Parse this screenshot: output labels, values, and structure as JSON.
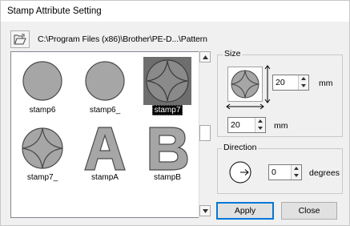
{
  "window": {
    "title": "Stamp Attribute Setting"
  },
  "toolbar": {
    "folder_icon": "open-folder-icon",
    "path": "C:\\Program Files (x86)\\Brother\\PE-D...\\Pattern"
  },
  "stamps": [
    {
      "label": "stamp6",
      "shape": "circle",
      "selected": false
    },
    {
      "label": "stamp6_",
      "shape": "circle",
      "selected": false
    },
    {
      "label": "stamp7",
      "shape": "circle-star",
      "selected": true
    },
    {
      "label": "stamp7_",
      "shape": "circle-star",
      "selected": false
    },
    {
      "label": "stampA",
      "shape": "letter-A",
      "selected": false
    },
    {
      "label": "stampB",
      "shape": "letter-B",
      "selected": false
    }
  ],
  "size": {
    "group_label": "Size",
    "height_value": "20",
    "height_unit": "mm",
    "width_value": "20",
    "width_unit": "mm"
  },
  "direction": {
    "group_label": "Direction",
    "value": "0",
    "unit": "degrees"
  },
  "buttons": {
    "apply": "Apply",
    "close": "Close"
  },
  "colors": {
    "stamp_fill": "#a6a6a6",
    "stamp_stroke": "#4a4a4a",
    "selected_bg": "#6e6e6e",
    "default_button_border": "#0078d7"
  }
}
